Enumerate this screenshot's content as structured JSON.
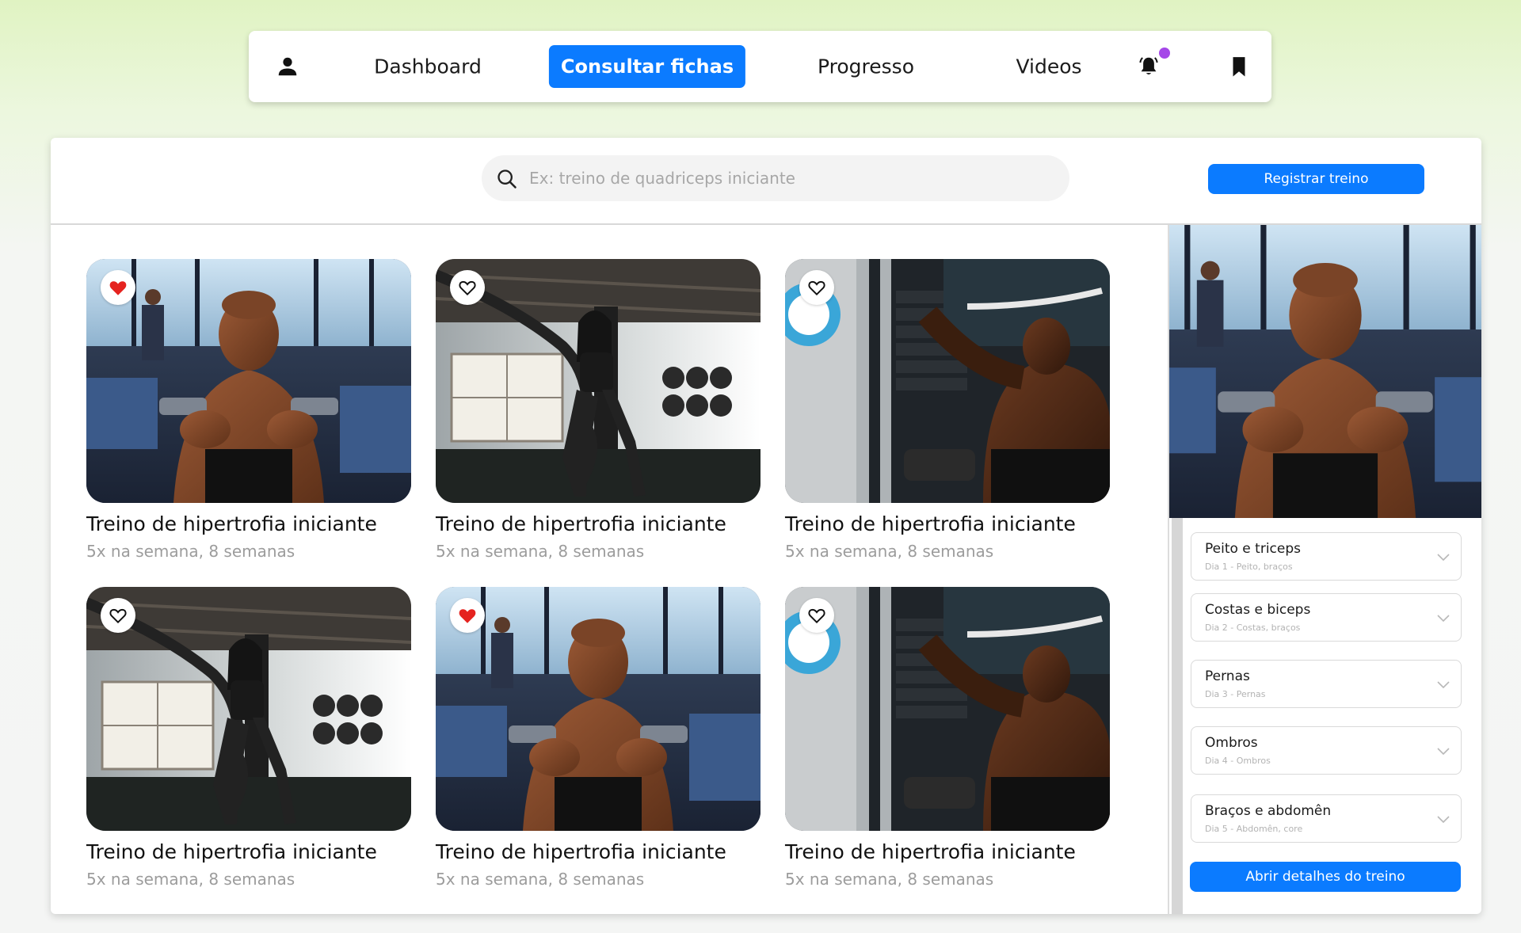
{
  "nav": {
    "items": [
      {
        "label": "Dashboard",
        "active": false
      },
      {
        "label": "Consultar fichas",
        "active": true
      },
      {
        "label": "Progresso",
        "active": false
      },
      {
        "label": "Videos",
        "active": false
      }
    ],
    "icons": {
      "profile": "user-icon",
      "notifications": "bell-icon",
      "saved": "bookmark-icon"
    },
    "notification_dot_color": "#a547e8"
  },
  "search": {
    "placeholder": "Ex: treino de quadriceps iniciante",
    "value": ""
  },
  "actions": {
    "register_label": "Registrar treino",
    "details_label": "Abrir detalhes do treino"
  },
  "colors": {
    "accent": "#0b7bff",
    "favorite": "#e5231f"
  },
  "workouts": [
    {
      "title": "Treino de hipertrofia iniciante",
      "subtitle": "5x na semana, 8 semanas",
      "favorited": true,
      "image": "man-dumbbells"
    },
    {
      "title": "Treino de hipertrofia iniciante",
      "subtitle": "5x na semana, 8 semanas",
      "favorited": false,
      "image": "woman-battle-ropes"
    },
    {
      "title": "Treino de hipertrofia iniciante",
      "subtitle": "5x na semana, 8 semanas",
      "favorited": false,
      "image": "man-cable-pulldown"
    },
    {
      "title": "Treino de hipertrofia iniciante",
      "subtitle": "5x na semana, 8 semanas",
      "favorited": false,
      "image": "woman-battle-ropes"
    },
    {
      "title": "Treino de hipertrofia iniciante",
      "subtitle": "5x na semana, 8 semanas",
      "favorited": true,
      "image": "man-dumbbells"
    },
    {
      "title": "Treino de hipertrofia iniciante",
      "subtitle": "5x na semana, 8 semanas",
      "favorited": false,
      "image": "man-cable-pulldown"
    }
  ],
  "detail": {
    "image": "man-dumbbells",
    "days": [
      {
        "title": "Peito e triceps",
        "subtitle": "Dia 1 - Peito, braços"
      },
      {
        "title": "Costas e biceps",
        "subtitle": "Dia 2 - Costas, braços"
      },
      {
        "title": "Pernas",
        "subtitle": "Dia 3 - Pernas"
      },
      {
        "title": "Ombros",
        "subtitle": "Dia 4 - Ombros"
      },
      {
        "title": "Braços e abdomên",
        "subtitle": "Dia 5 - Abdomên, core"
      }
    ]
  }
}
